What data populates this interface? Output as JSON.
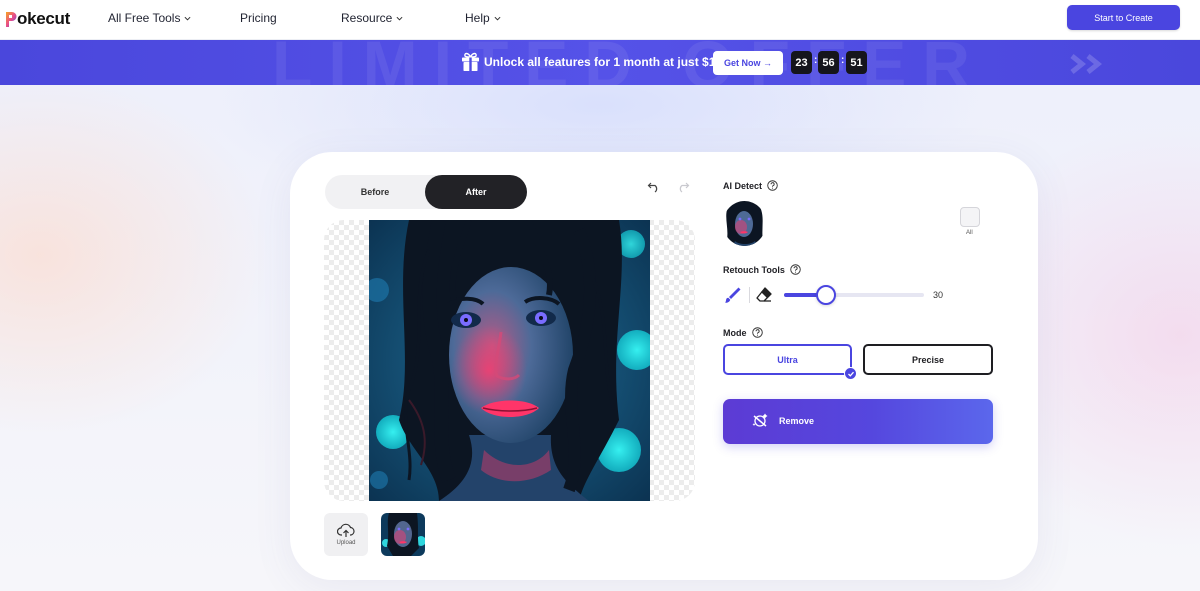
{
  "brand": {
    "name": "okecut",
    "logo_icon": "pokecut-logo-icon"
  },
  "nav": {
    "items": [
      {
        "label": "All Free Tools",
        "has_dropdown": true
      },
      {
        "label": "Pricing",
        "has_dropdown": false
      },
      {
        "label": "Resource",
        "has_dropdown": true
      },
      {
        "label": "Help",
        "has_dropdown": true
      }
    ],
    "cta_label": "Start to Create"
  },
  "promo": {
    "watermark": "LIMITED OFFER",
    "text": "Unlock all features for 1 month at just $1!",
    "button_label": "Get Now →",
    "timer": {
      "hours": "23",
      "minutes": "56",
      "seconds": "51"
    }
  },
  "editor": {
    "toggle": {
      "before_label": "Before",
      "after_label": "After",
      "active": "After"
    },
    "upload_label": "Upload"
  },
  "panel": {
    "ai_detect": {
      "label": "AI Detect",
      "all_label": "All"
    },
    "retouch": {
      "label": "Retouch Tools",
      "brush_size": 30,
      "brush_max": 100
    },
    "mode": {
      "label": "Mode",
      "options": [
        "Ultra",
        "Precise"
      ],
      "selected": "Ultra"
    },
    "remove_label": "Remove"
  },
  "colors": {
    "accent": "#4a45e0",
    "dark": "#222226"
  }
}
